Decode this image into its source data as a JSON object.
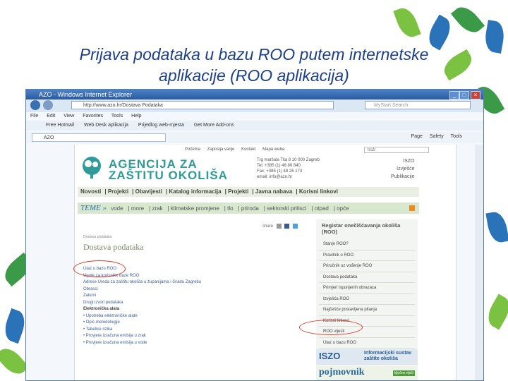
{
  "slide": {
    "title_line1": "Prijava podataka u bazu ROO putem internetske",
    "title_line2": "aplikacije (ROO aplikacija)"
  },
  "browser": {
    "window_title": "AZO - Windows Internet Explorer",
    "address": "http://www.azo.hr/Dostava Podataka",
    "search_placeholder": "MyStart Search",
    "menu": [
      "File",
      "Edit",
      "View",
      "Favorites",
      "Tools",
      "Help"
    ],
    "favorites": [
      "Free Hotmail",
      "Web Desk aplikacija",
      "Prijedlog web-mjesta",
      "Get More Add-ons"
    ],
    "tab_title": "AZO",
    "tools": [
      "Page",
      "Safety",
      "Tools"
    ]
  },
  "site": {
    "top_links": [
      "Početna",
      "Zaposlja vanje",
      "Kontakt",
      "Mapa weba"
    ],
    "search_placeholder": "traži",
    "logo_line1": "AGENCIJA ZA",
    "logo_line2": "ZAŠTITU OKOLIŠA",
    "contact": [
      "Trg maršala Tita 8 10 000 Zagreb",
      "Tel: +385 (1) 48 86 840",
      "Fax: +385 (1) 48 26 173",
      "email: info@azo.hr"
    ],
    "right_links": [
      "ISZO",
      "Izvješće",
      "Publikacije"
    ],
    "main_nav": [
      "Novosti",
      "Projekti",
      "Obavijesti",
      "Katalog informacija",
      "Projekti",
      "Javna nabava",
      "Korisni linkovi"
    ],
    "teme_label": "TEME »",
    "teme": [
      "vode",
      "more",
      "zrak",
      "klimatske promjene",
      "tlo",
      "priroda",
      "sektorski pritisci",
      "otpad",
      "opće"
    ],
    "share_label": "share",
    "breadcrumb": "Dostava podataka",
    "heading": "Dostava podataka",
    "links": [
      "Ulaz u bazu ROO",
      "Upute za korisnike baze ROO",
      "Adrese Ureda za zaštitu okoliša u županijama i Gradu Zagrebu",
      "Obrasci",
      "Zakoni",
      "Drugi izvori podataka",
      "Elektronička alata"
    ],
    "tools_links": [
      "• Upotreba elektroničke alate",
      "• Opis metodologije",
      "• Tabelice rizika",
      "• Provjere izračuna emisija u zrak",
      "• Provjere izračuna emisija u vode"
    ],
    "registry_title_1": "Registar onečišćavanja okoliša",
    "registry_title_2": "(ROO)",
    "registry_items": [
      "Stanje ROO?",
      "Pravilnik o ROO",
      "Priručnik uz vođenje ROO",
      "Dostava podataka",
      "Primjeri ispunjenih obrazaca",
      "Izvješća ROO",
      "Najčešće postavljena pitanja",
      "Korisni linkovi",
      "ROO vijesti",
      "Ulaz u bazu ROO"
    ],
    "iszo_logo": "ISZO",
    "iszo_text_1": "Informacijski sustav",
    "iszo_text_2": "zaštite okoliša",
    "pojmovnik": "pojmovnik",
    "pojmovnik_badge": "ključne riječi"
  },
  "colors": {
    "title": "#1c3f8c",
    "annotation_circle": "#d63a2a",
    "logo": "#2f9a9a"
  }
}
